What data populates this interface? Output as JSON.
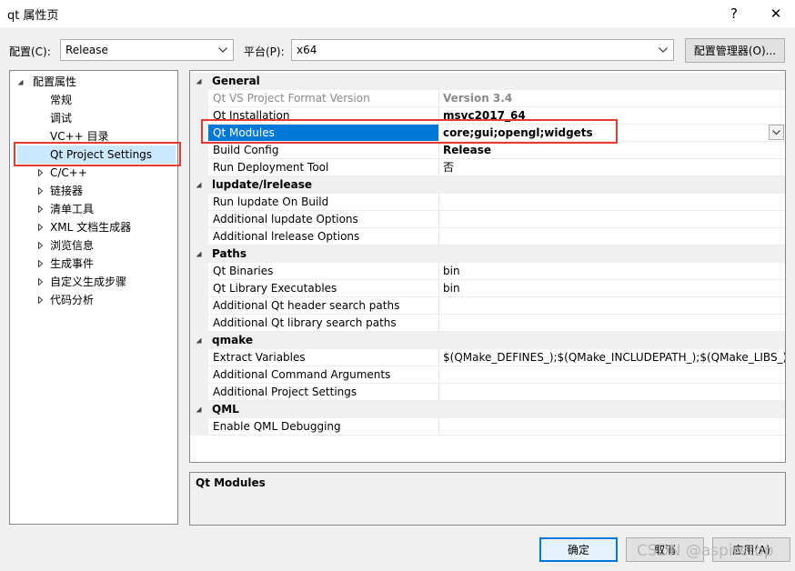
{
  "window": {
    "title": "qt 属性页",
    "help_glyph": "?",
    "close_glyph": "✕"
  },
  "config_bar": {
    "config_label": "配置(C):",
    "config_value": "Release",
    "platform_label": "平台(P):",
    "platform_value": "x64",
    "manager_button": "配置管理器(O)..."
  },
  "tree": {
    "root": "配置属性",
    "items": [
      {
        "label": "常规",
        "expandable": false
      },
      {
        "label": "调试",
        "expandable": false
      },
      {
        "label": "VC++ 目录",
        "expandable": false
      },
      {
        "label": "Qt Project Settings",
        "expandable": false,
        "selected": true
      },
      {
        "label": "C/C++",
        "expandable": true
      },
      {
        "label": "链接器",
        "expandable": true
      },
      {
        "label": "清单工具",
        "expandable": true
      },
      {
        "label": "XML 文档生成器",
        "expandable": true
      },
      {
        "label": "浏览信息",
        "expandable": true
      },
      {
        "label": "生成事件",
        "expandable": true
      },
      {
        "label": "自定义生成步骤",
        "expandable": true
      },
      {
        "label": "代码分析",
        "expandable": true
      }
    ]
  },
  "grid": {
    "categories": [
      {
        "name": "General",
        "rows": [
          {
            "name": "Qt VS Project Format Version",
            "value": "Version 3.4",
            "dim": true,
            "bold": true
          },
          {
            "name": "Qt Installation",
            "value": "msvc2017_64",
            "bold": true
          },
          {
            "name": "Qt Modules",
            "value": "core;gui;opengl;widgets",
            "bold": true,
            "selected": true
          },
          {
            "name": "Build Config",
            "value": "Release",
            "bold": true
          },
          {
            "name": "Run Deployment Tool",
            "value": "否"
          }
        ]
      },
      {
        "name": "lupdate/lrelease",
        "rows": [
          {
            "name": "Run lupdate On Build",
            "value": ""
          },
          {
            "name": "Additional lupdate Options",
            "value": ""
          },
          {
            "name": "Additional lrelease Options",
            "value": ""
          }
        ]
      },
      {
        "name": "Paths",
        "rows": [
          {
            "name": "Qt Binaries",
            "value": "bin"
          },
          {
            "name": "Qt Library Executables",
            "value": "bin"
          },
          {
            "name": "Additional Qt header search paths",
            "value": ""
          },
          {
            "name": "Additional Qt library search paths",
            "value": ""
          }
        ]
      },
      {
        "name": "qmake",
        "rows": [
          {
            "name": "Extract Variables",
            "value": "$(QMake_DEFINES_);$(QMake_INCLUDEPATH_);$(QMake_LIBS_);$"
          },
          {
            "name": "Additional Command Arguments",
            "value": ""
          },
          {
            "name": "Additional Project Settings",
            "value": ""
          }
        ]
      },
      {
        "name": "QML",
        "rows": [
          {
            "name": "Enable QML Debugging",
            "value": ""
          }
        ]
      }
    ]
  },
  "description": {
    "title": "Qt Modules"
  },
  "buttons": {
    "ok": "确定",
    "cancel": "取消",
    "apply": "应用(A)"
  },
  "watermark": "CSDN @aspiretop",
  "colors": {
    "selection": "#0078d7",
    "highlight_box": "#e53935"
  }
}
